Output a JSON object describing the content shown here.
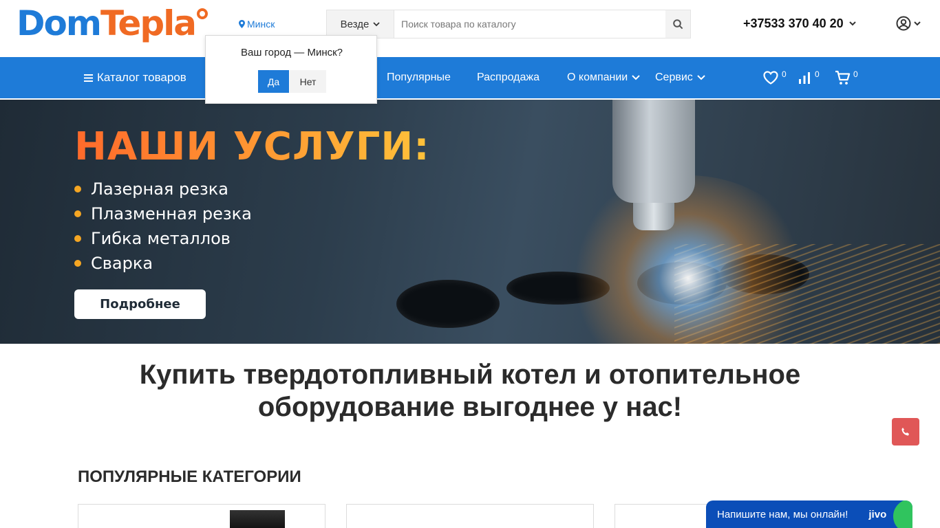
{
  "header": {
    "logo": {
      "part1": "Dom",
      "part2": "Tepla"
    },
    "city": "Минск",
    "search": {
      "scope": "Везде",
      "placeholder": "Поиск товара по каталогу"
    },
    "phone": "+37533 370 40 20"
  },
  "nav": {
    "catalog": "Каталог товаров",
    "items": [
      {
        "label": "Популярные"
      },
      {
        "label": "Распродажа"
      },
      {
        "label": "О компании"
      },
      {
        "label": "Сервис"
      }
    ],
    "favorites_count": "0",
    "compare_count": "0",
    "cart_count": "0"
  },
  "city_popup": {
    "question": "Ваш город — Минск?",
    "yes": "Да",
    "no": "Нет"
  },
  "banner": {
    "title": "НАШИ УСЛУГИ:",
    "services": [
      "Лазерная резка",
      "Плазменная резка",
      "Гибка металлов",
      "Сварка"
    ],
    "button": "Подробнее"
  },
  "main": {
    "headline_line1": "Купить твердотопливный котел и отопительное",
    "headline_line2": "оборудование выгоднее у нас!",
    "section_title": "ПОПУЛЯРНЫЕ КАТЕГОРИИ"
  },
  "chat": {
    "text": "Напишите нам, мы онлайн!",
    "brand": "jivo"
  },
  "colors": {
    "brand_blue": "#1e7bd8",
    "brand_orange": "#f06a23",
    "call_red": "#e05757",
    "chat_blue": "#0b4eb8"
  }
}
